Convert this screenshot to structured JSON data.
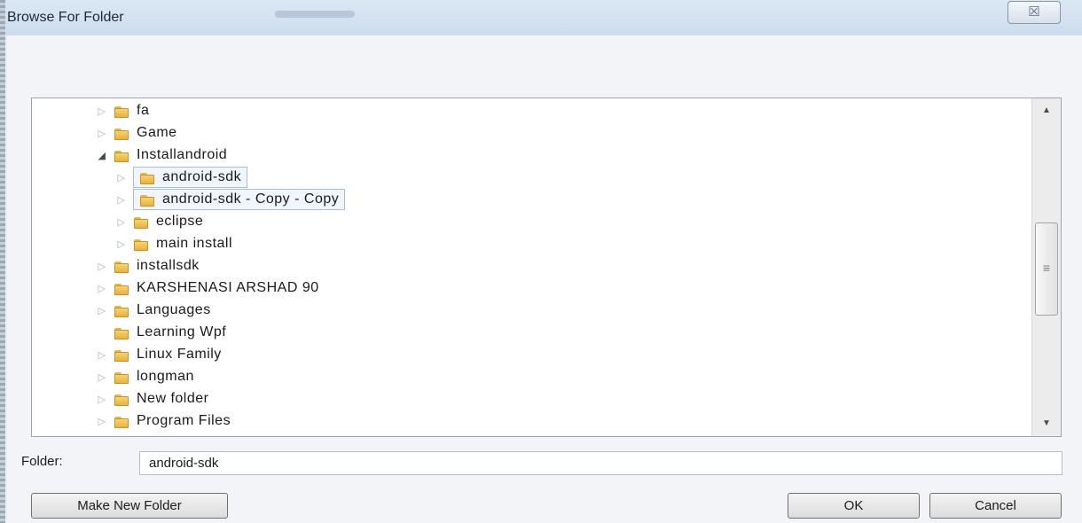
{
  "window": {
    "title": "Browse For Folder",
    "close_glyph": "☒"
  },
  "tree": {
    "items": [
      {
        "label": "fa",
        "level": 0,
        "arrow": "collapsed",
        "selected": false
      },
      {
        "label": "Game",
        "level": 0,
        "arrow": "collapsed",
        "selected": false
      },
      {
        "label": "Installandroid",
        "level": 0,
        "arrow": "expanded",
        "selected": false
      },
      {
        "label": "android-sdk",
        "level": 1,
        "arrow": "collapsed",
        "selected": true
      },
      {
        "label": "android-sdk - Copy - Copy",
        "level": 1,
        "arrow": "collapsed",
        "selected": true
      },
      {
        "label": "eclipse",
        "level": 1,
        "arrow": "collapsed",
        "selected": false
      },
      {
        "label": "main install",
        "level": 1,
        "arrow": "collapsed",
        "selected": false
      },
      {
        "label": "installsdk",
        "level": 0,
        "arrow": "collapsed",
        "selected": false
      },
      {
        "label": "KARSHENASI ARSHAD 90",
        "level": 0,
        "arrow": "collapsed",
        "selected": false
      },
      {
        "label": "Languages",
        "level": 0,
        "arrow": "collapsed",
        "selected": false
      },
      {
        "label": "Learning Wpf",
        "level": 0,
        "arrow": "none",
        "selected": false
      },
      {
        "label": "Linux Family",
        "level": 0,
        "arrow": "collapsed",
        "selected": false
      },
      {
        "label": "longman",
        "level": 0,
        "arrow": "collapsed",
        "selected": false
      },
      {
        "label": "New folder",
        "level": 0,
        "arrow": "collapsed",
        "selected": false
      },
      {
        "label": "Program Files",
        "level": 0,
        "arrow": "collapsed",
        "selected": false
      }
    ]
  },
  "scrollbar": {
    "up_glyph": "▲",
    "down_glyph": "▼",
    "grip_glyph": "≡"
  },
  "folder": {
    "label": "Folder:",
    "value": "android-sdk"
  },
  "buttons": {
    "make_new_folder": "Make New Folder",
    "ok": "OK",
    "cancel": "Cancel"
  },
  "icons": {
    "folder": "folder-icon",
    "collapsed": "▷",
    "expanded": "◢"
  }
}
